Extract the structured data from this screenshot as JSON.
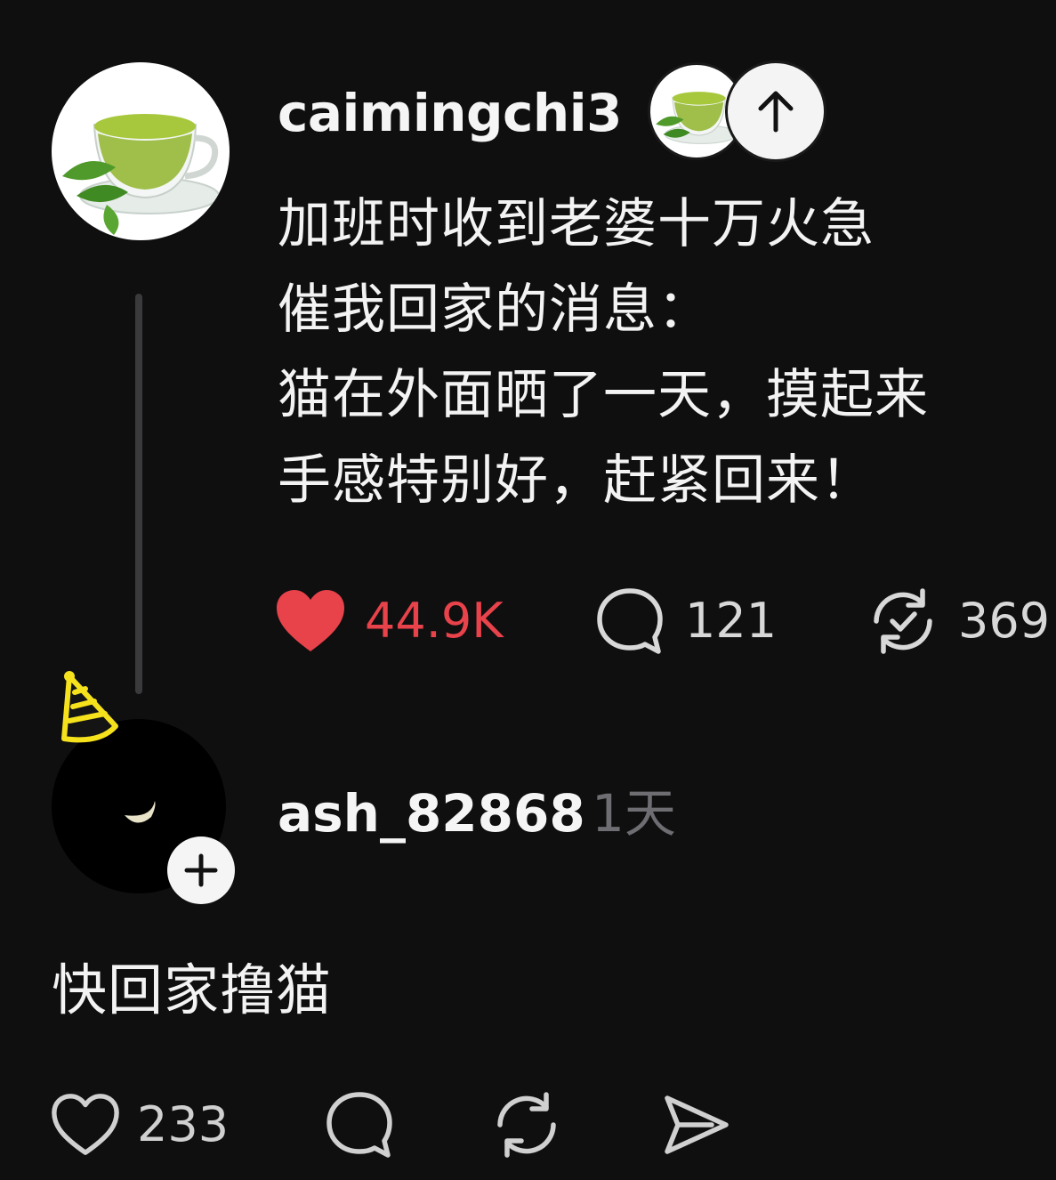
{
  "post": {
    "username": "caimingchi3",
    "text_lines": [
      "加班时收到老婆十万火急",
      "催我回家的消息：",
      "猫在外面晒了一天，摸起来",
      "手感特别好，赶紧回来！"
    ],
    "likes": "44.9K",
    "replies": "121",
    "reposts": "369",
    "like_color": "#e8424a"
  },
  "reply": {
    "username": "ash_82868",
    "time": "1天",
    "text": "快回家撸猫",
    "likes": "233"
  },
  "icons": {
    "avatar_main": "green-tea-cup",
    "upvote": "arrow-up-icon",
    "like": "heart-icon",
    "reply": "speech-bubble-icon",
    "repost": "repost-icon",
    "share": "send-icon",
    "follow": "plus-icon",
    "party_hat": "party-hat-icon"
  }
}
